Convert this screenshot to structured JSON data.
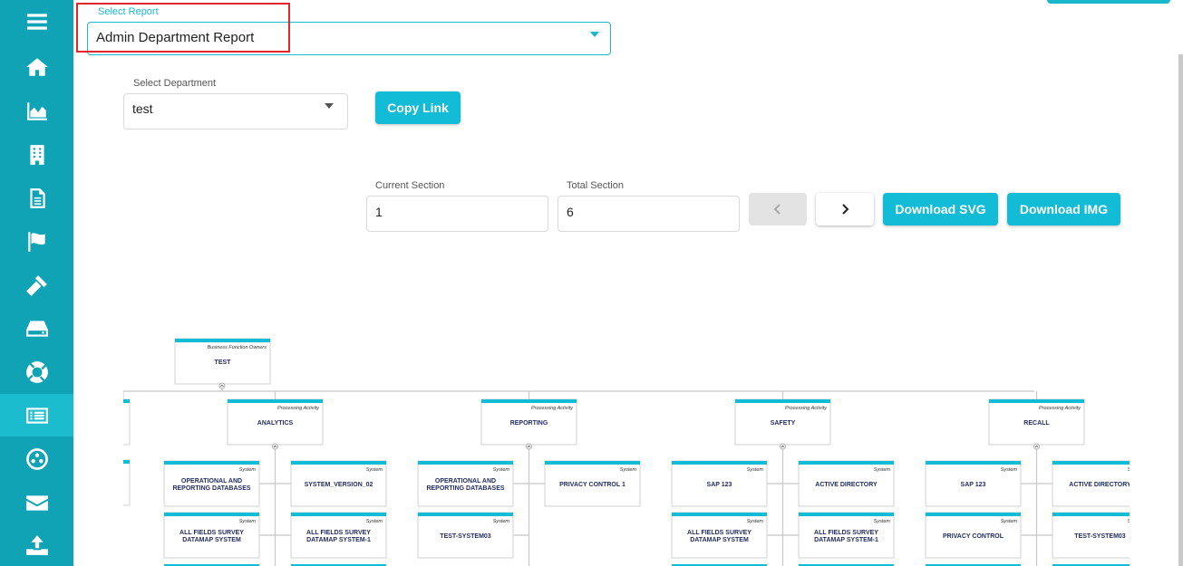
{
  "report": {
    "label": "Select Report",
    "value": "Admin Department Report"
  },
  "department": {
    "label": "Select Department",
    "value": "test"
  },
  "copy_link_label": "Copy Link",
  "current_section": {
    "label": "Current Section",
    "value": "1"
  },
  "total_section": {
    "label": "Total Section",
    "value": "6"
  },
  "download_svg_label": "Download SVG",
  "download_img_label": "Download IMG",
  "sidebar": {
    "items": [
      {
        "icon": "menu-icon"
      },
      {
        "icon": "home-icon"
      },
      {
        "icon": "area-chart-icon"
      },
      {
        "icon": "building-icon"
      },
      {
        "icon": "document-icon"
      },
      {
        "icon": "flag-icon"
      },
      {
        "icon": "gavel-icon"
      },
      {
        "icon": "hard-drive-icon"
      },
      {
        "icon": "life-ring-icon"
      },
      {
        "icon": "list-alt-icon"
      },
      {
        "icon": "network-icon"
      },
      {
        "icon": "envelope-icon"
      },
      {
        "icon": "upload-icon"
      }
    ],
    "active_index": 9
  },
  "colors": {
    "sidebar": "#0fa3b5",
    "accent": "#12bcd6",
    "highlight": "#e3262a"
  },
  "org_chart": {
    "root": {
      "type": "Business Function Owners",
      "name": "TEST"
    },
    "activities": [
      {
        "type": "Processing Activity",
        "name": "ANALYTICS",
        "systems": [
          {
            "type": "System",
            "name": "OPERATIONAL AND REPORTING DATABASES"
          },
          {
            "type": "System",
            "name": "SYSTEM_VERSION_02"
          },
          {
            "type": "System",
            "name": "ALL FIELDS SURVEY DATAMAP SYSTEM"
          },
          {
            "type": "System",
            "name": "ALL FIELDS SURVEY DATAMAP SYSTEM-1"
          }
        ]
      },
      {
        "type": "Processing Activity",
        "name": "REPORTING",
        "systems": [
          {
            "type": "System",
            "name": "OPERATIONAL AND REPORTING DATABASES"
          },
          {
            "type": "System",
            "name": "PRIVACY CONTROL 1"
          },
          {
            "type": "System",
            "name": "TEST-SYSTEM03"
          }
        ]
      },
      {
        "type": "Processing Activity",
        "name": "SAFETY",
        "systems": [
          {
            "type": "System",
            "name": "SAP 123"
          },
          {
            "type": "System",
            "name": "ACTIVE DIRECTORY"
          },
          {
            "type": "System",
            "name": "ALL FIELDS SURVEY DATAMAP SYSTEM"
          },
          {
            "type": "System",
            "name": "ALL FIELDS SURVEY DATAMAP SYSTEM-1"
          }
        ]
      },
      {
        "type": "Processing Activity",
        "name": "RECALL",
        "systems": [
          {
            "type": "System",
            "name": "SAP 123"
          },
          {
            "type": "System",
            "name": "ACTIVE DIRECTORY"
          },
          {
            "type": "System",
            "name": "PRIVACY CONTROL"
          },
          {
            "type": "System",
            "name": "TEST-SYSTEM03"
          }
        ]
      }
    ]
  }
}
